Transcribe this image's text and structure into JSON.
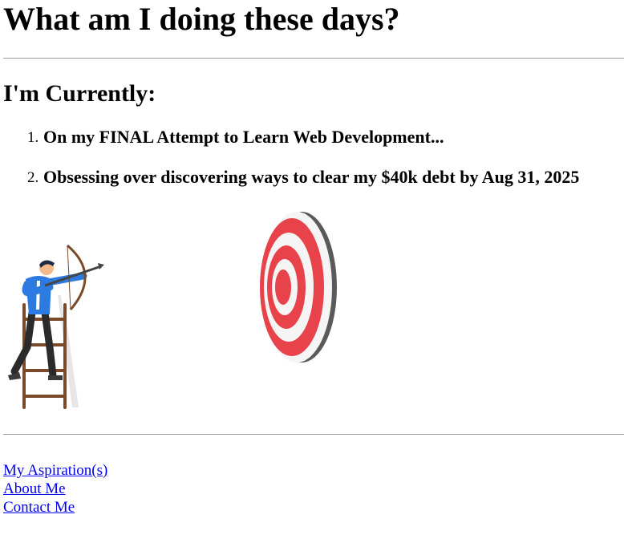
{
  "page": {
    "title": "What am I doing these days?",
    "section_heading": "I'm Currently:",
    "tasks": [
      {
        "number": "1.",
        "text": "On my FINAL Attempt to Learn Web Development..."
      },
      {
        "number": "2.",
        "text": "Obsessing over discovering ways to clear my $40k debt by Aug 31, 2025"
      }
    ]
  },
  "illustration": {
    "archer_icon": "archer-on-ladder-icon",
    "target_icon": "bullseye-target-icon",
    "colors": {
      "target_red": "#e8434a",
      "target_white": "#f5f5f5",
      "target_rim": "#5a5a5a",
      "shirt": "#2d7be0",
      "ladder": "#7a4a2a"
    }
  },
  "nav_links": [
    {
      "label": "My Aspiration(s)"
    },
    {
      "label": "About Me"
    },
    {
      "label": "Contact Me"
    }
  ]
}
